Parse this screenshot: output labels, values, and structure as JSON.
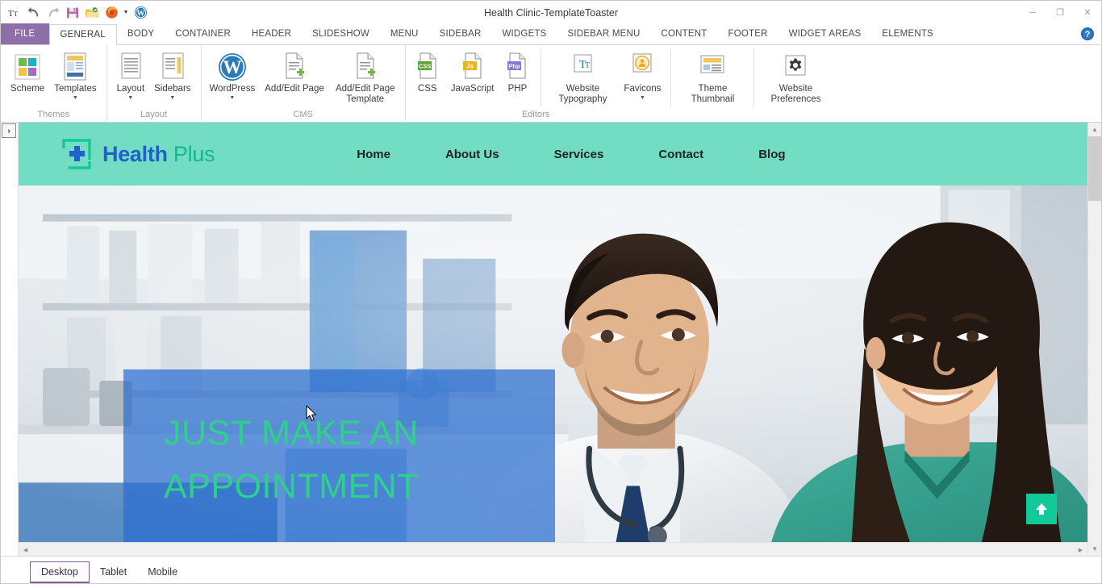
{
  "window": {
    "title": "Health Clinic-TemplateToaster",
    "minimize_label": "─",
    "maximize_label": "❐",
    "close_label": "✕"
  },
  "quick_access": [
    {
      "name": "text-tool-icon",
      "label": "Tt"
    },
    {
      "name": "undo-icon",
      "label": "Undo"
    },
    {
      "name": "redo-icon",
      "label": "Redo"
    },
    {
      "name": "save-icon",
      "label": "Save"
    },
    {
      "name": "open-folder-icon",
      "label": "Open"
    },
    {
      "name": "firefox-preview-icon",
      "label": "Preview in Browser"
    },
    {
      "name": "wordpress-icon",
      "label": "WordPress"
    }
  ],
  "ribbon": {
    "file_tab": "FILE",
    "tabs": [
      {
        "label": "GENERAL",
        "active": true
      },
      {
        "label": "BODY",
        "active": false
      },
      {
        "label": "CONTAINER",
        "active": false
      },
      {
        "label": "HEADER",
        "active": false
      },
      {
        "label": "SLIDESHOW",
        "active": false
      },
      {
        "label": "MENU",
        "active": false
      },
      {
        "label": "SIDEBAR",
        "active": false
      },
      {
        "label": "WIDGETS",
        "active": false
      },
      {
        "label": "SIDEBAR MENU",
        "active": false
      },
      {
        "label": "CONTENT",
        "active": false
      },
      {
        "label": "FOOTER",
        "active": false
      },
      {
        "label": "WIDGET AREAS",
        "active": false
      },
      {
        "label": "ELEMENTS",
        "active": false
      }
    ],
    "help_label": "?",
    "groups": [
      {
        "title": "Themes",
        "buttons": [
          {
            "name": "scheme-button",
            "label": "Scheme",
            "icon": "color-scheme-icon",
            "has_caret": false
          },
          {
            "name": "templates-button",
            "label": "Templates",
            "icon": "template-page-icon",
            "has_caret": true
          }
        ]
      },
      {
        "title": "Layout",
        "buttons": [
          {
            "name": "layout-button",
            "label": "Layout",
            "icon": "layout-page-icon",
            "has_caret": true
          },
          {
            "name": "sidebars-button",
            "label": "Sidebars",
            "icon": "sidebars-page-icon",
            "has_caret": true
          }
        ]
      },
      {
        "title": "CMS",
        "buttons": [
          {
            "name": "wordpress-button",
            "label": "WordPress",
            "icon": "wordpress-icon",
            "has_caret": true
          },
          {
            "name": "add-edit-page-button",
            "label": "Add/Edit Page",
            "icon": "page-plus-icon",
            "has_caret": false
          },
          {
            "name": "add-edit-page-template-button",
            "label": "Add/Edit Page Template",
            "icon": "page-plus-icon",
            "has_caret": false
          }
        ]
      },
      {
        "title": "Editors",
        "buttons": [
          {
            "name": "css-button",
            "label": "CSS",
            "icon": "css-file-icon",
            "badge": "CSS",
            "badge_color": "#5fa336",
            "has_caret": false
          },
          {
            "name": "javascript-button",
            "label": "JavaScript",
            "icon": "js-file-icon",
            "badge": "Js",
            "badge_color": "#e8b422",
            "has_caret": false
          },
          {
            "name": "php-button",
            "label": "PHP",
            "icon": "php-file-icon",
            "badge": "Php",
            "badge_color": "#7b79e0",
            "has_caret": false
          },
          {
            "name": "website-typography-button",
            "label": "Website Typography",
            "icon": "typography-icon",
            "has_caret": false
          },
          {
            "name": "favicons-button",
            "label": "Favicons",
            "icon": "favicon-icon",
            "has_caret": true
          },
          {
            "name": "theme-thumbnail-button",
            "label": "Theme Thumbnail",
            "icon": "thumbnail-icon",
            "has_caret": false
          },
          {
            "name": "website-preferences-button",
            "label": "Website Preferences",
            "icon": "gear-icon",
            "has_caret": false
          }
        ]
      }
    ]
  },
  "preview": {
    "rail_toggle_label": "›",
    "site": {
      "header_bg": "#72ddc3",
      "logo": {
        "primary": "Health",
        "secondary": "Plus",
        "mark": "health-cross-icon"
      },
      "nav": [
        {
          "label": "Home"
        },
        {
          "label": "About Us"
        },
        {
          "label": "Services"
        },
        {
          "label": "Contact"
        },
        {
          "label": "Blog"
        }
      ],
      "slide": {
        "caption_line1": "JUST MAKE AN",
        "caption_line2": "APPOINTMENT",
        "caption_color": "#2fd18a",
        "overlay_color": "#296dd0"
      },
      "scroll_top_label": "↑"
    },
    "scrollbar": {
      "up": "▲",
      "down": "▼",
      "left": "◀",
      "right": "▶"
    }
  },
  "device_tabs": [
    {
      "label": "Desktop",
      "active": true
    },
    {
      "label": "Tablet",
      "active": false
    },
    {
      "label": "Mobile",
      "active": false
    }
  ]
}
